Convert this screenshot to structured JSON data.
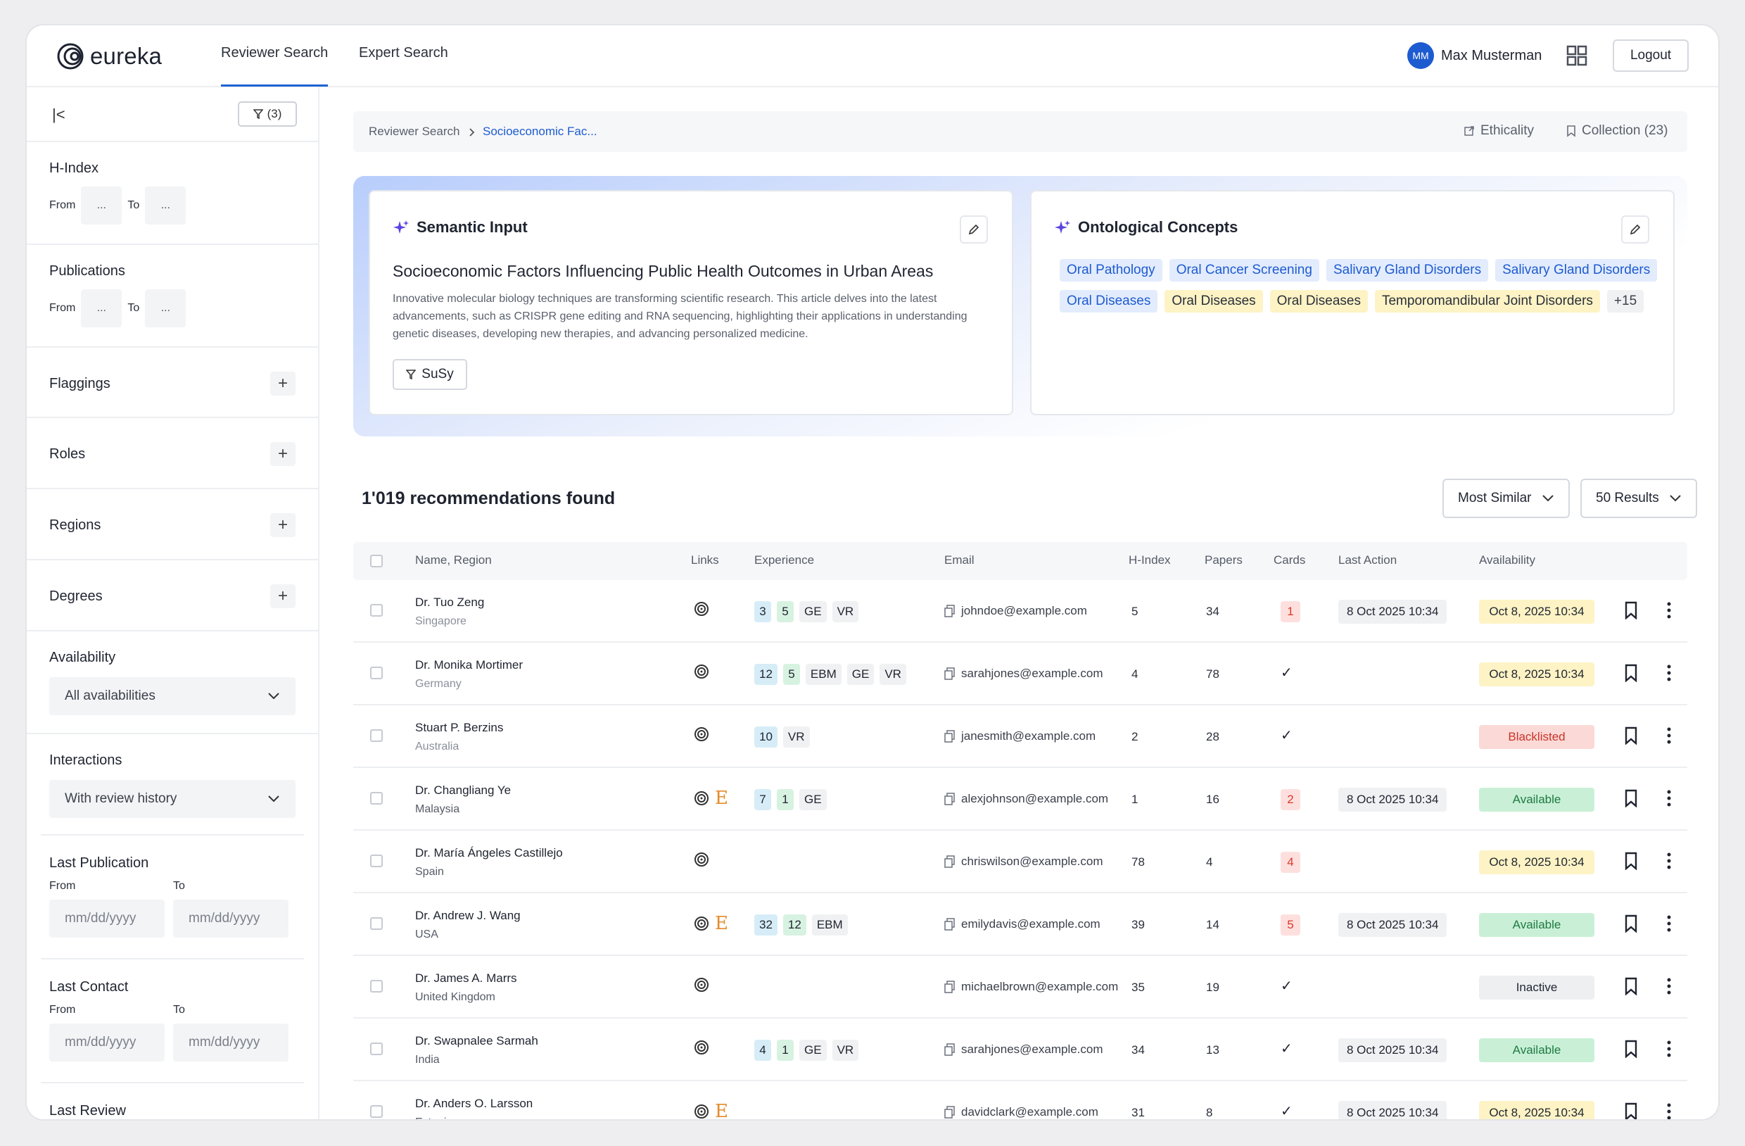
{
  "header": {
    "logo_text": "eureka",
    "tabs": [
      {
        "label": "Reviewer Search"
      },
      {
        "label": "Expert Search"
      }
    ],
    "user": {
      "initials": "MM",
      "name": "Max Musterman"
    },
    "logout_label": "Logout"
  },
  "sidebar": {
    "filter_count": "(3)",
    "h_index": {
      "label": "H-Index",
      "from_label": "From",
      "to_label": "To",
      "from_value": "...",
      "to_value": "..."
    },
    "publications": {
      "label": "Publications",
      "from_label": "From",
      "to_label": "To",
      "from_value": "...",
      "to_value": "..."
    },
    "flaggings_label": "Flaggings",
    "roles_label": "Roles",
    "regions_label": "Regions",
    "degrees_label": "Degrees",
    "availability": {
      "label": "Availability",
      "value": "All availabilities"
    },
    "interactions": {
      "label": "Interactions",
      "value": "With review history"
    },
    "last_publication": {
      "label": "Last Publication",
      "from_label": "From",
      "to_label": "To",
      "placeholder": "mm/dd/yyyy"
    },
    "last_contact": {
      "label": "Last Contact",
      "from_label": "From",
      "to_label": "To",
      "placeholder": "mm/dd/yyyy"
    },
    "last_review_label": "Last Review"
  },
  "breadcrumb": {
    "root": "Reviewer Search",
    "current": "Socioeconomic Fac...",
    "ethicality": "Ethicality",
    "collection": "Collection (23)"
  },
  "semantic": {
    "title": "Semantic Input",
    "heading": "Socioeconomic Factors Influencing Public Health Outcomes in Urban Areas",
    "description": "Innovative molecular biology techniques are transforming scientific research. This article delves into the latest advancements, such as CRISPR gene editing and RNA sequencing, highlighting their applications in understanding genetic diseases, developing new therapies, and advancing personalized medicine.",
    "filter_label": "SuSy"
  },
  "ontology": {
    "title": "Ontological Concepts",
    "concepts": [
      {
        "label": "Oral Pathology",
        "color": "blue"
      },
      {
        "label": "Oral Cancer Screening",
        "color": "blue"
      },
      {
        "label": "Salivary Gland Disorders",
        "color": "blue"
      },
      {
        "label": "Salivary Gland Disorders",
        "color": "blue"
      },
      {
        "label": "Oral Diseases",
        "color": "blue"
      },
      {
        "label": "Oral Diseases",
        "color": "yellow"
      },
      {
        "label": "Oral Diseases",
        "color": "yellow"
      },
      {
        "label": "Temporomandibular Joint Disorders",
        "color": "yellow"
      },
      {
        "label": "+15",
        "color": "gray"
      }
    ]
  },
  "results": {
    "count_label": "1'019 recommendations found",
    "sort_label": "Most Similar",
    "page_size_label": "50 Results"
  },
  "table": {
    "columns": [
      "Name, Region",
      "Links",
      "Experience",
      "Email",
      "H-Index",
      "Papers",
      "Cards",
      "Last Action",
      "Availability"
    ],
    "rows": [
      {
        "name": "Dr. Tuo Zeng",
        "region": "Singapore",
        "region_muted": true,
        "e_link": false,
        "experience": [
          {
            "t": "3",
            "c": "cyan"
          },
          {
            "t": "5",
            "c": "green"
          },
          {
            "t": "GE",
            "c": "grey"
          },
          {
            "t": "VR",
            "c": "grey"
          }
        ],
        "email": "johndoe@example.com",
        "h_index": "5",
        "papers": "34",
        "cards": "1",
        "last_action": "8 Oct 2025 10:34",
        "availability": "Oct 8, 2025 10:34",
        "avail_color": "yellow"
      },
      {
        "name": "Dr. Monika Mortimer",
        "region": "Germany",
        "region_muted": true,
        "e_link": false,
        "experience": [
          {
            "t": "12",
            "c": "cyan"
          },
          {
            "t": "5",
            "c": "green"
          },
          {
            "t": "EBM",
            "c": "grey"
          },
          {
            "t": "GE",
            "c": "grey"
          },
          {
            "t": "VR",
            "c": "grey"
          }
        ],
        "email": "sarahjones@example.com",
        "h_index": "4",
        "papers": "78",
        "cards": "✓",
        "last_action": "",
        "availability": "Oct 8, 2025 10:34",
        "avail_color": "yellow"
      },
      {
        "name": "Stuart P. Berzins",
        "region": "Australia",
        "region_muted": true,
        "e_link": false,
        "experience": [
          {
            "t": "10",
            "c": "cyan"
          },
          {
            "t": "VR",
            "c": "grey"
          }
        ],
        "email": "janesmith@example.com",
        "h_index": "2",
        "papers": "28",
        "cards": "✓",
        "last_action": "",
        "availability": "Blacklisted",
        "avail_color": "red"
      },
      {
        "name": "Dr. Changliang Ye",
        "region": "Malaysia",
        "region_muted": false,
        "e_link": true,
        "experience": [
          {
            "t": "7",
            "c": "cyan"
          },
          {
            "t": "1",
            "c": "green"
          },
          {
            "t": "GE",
            "c": "grey"
          }
        ],
        "email": "alexjohnson@example.com",
        "h_index": "1",
        "papers": "16",
        "cards": "2",
        "last_action": "8 Oct 2025 10:34",
        "availability": "Available",
        "avail_color": "green"
      },
      {
        "name": "Dr. María Ángeles Castillejo",
        "region": "Spain",
        "region_muted": false,
        "e_link": false,
        "experience": [],
        "email": "chriswilson@example.com",
        "h_index": "78",
        "papers": "4",
        "cards": "4",
        "last_action": "",
        "availability": "Oct 8, 2025 10:34",
        "avail_color": "yellow"
      },
      {
        "name": "Dr. Andrew J. Wang",
        "region": "USA",
        "region_muted": false,
        "e_link": true,
        "experience": [
          {
            "t": "32",
            "c": "cyan"
          },
          {
            "t": "12",
            "c": "green"
          },
          {
            "t": "EBM",
            "c": "grey"
          }
        ],
        "email": "emilydavis@example.com",
        "h_index": "39",
        "papers": "14",
        "cards": "5",
        "last_action": "8 Oct 2025 10:34",
        "availability": "Available",
        "avail_color": "green"
      },
      {
        "name": "Dr. James A. Marrs",
        "region": "United Kingdom",
        "region_muted": false,
        "e_link": false,
        "experience": [],
        "email": "michaelbrown@example.com",
        "h_index": "35",
        "papers": "19",
        "cards": "✓",
        "last_action": "",
        "availability": "Inactive",
        "avail_color": "gray"
      },
      {
        "name": "Dr. Swapnalee Sarmah",
        "region": "India",
        "region_muted": false,
        "e_link": false,
        "experience": [
          {
            "t": "4",
            "c": "cyan"
          },
          {
            "t": "1",
            "c": "green"
          },
          {
            "t": "GE",
            "c": "grey"
          },
          {
            "t": "VR",
            "c": "grey"
          }
        ],
        "email": "sarahjones@example.com",
        "h_index": "34",
        "papers": "13",
        "cards": "✓",
        "last_action": "8 Oct 2025 10:34",
        "availability": "Available",
        "avail_color": "green"
      },
      {
        "name": "Dr. Anders O. Larsson",
        "region": "Estonia",
        "region_muted": false,
        "e_link": true,
        "experience": [],
        "email": "davidclark@example.com",
        "h_index": "31",
        "papers": "8",
        "cards": "✓",
        "last_action": "8 Oct 2025 10:34",
        "availability": "Oct 8, 2025 10:34",
        "avail_color": "yellow"
      }
    ]
  },
  "colors": {
    "accent": "#1e63d3",
    "avatar": "#1d5bd0",
    "e_icon": "#e58b2b"
  },
  "icons": [
    "eureka-logo-icon",
    "grid-icon",
    "collapse-sidebar-icon",
    "filter-icon",
    "plus-icon",
    "chevron-down-icon",
    "chevron-right-icon",
    "external-link-icon",
    "bookmark-icon",
    "sparkle-icon",
    "pencil-icon",
    "orcid-icon",
    "e-icon",
    "copy-icon",
    "check-icon",
    "more-vertical-icon"
  ]
}
